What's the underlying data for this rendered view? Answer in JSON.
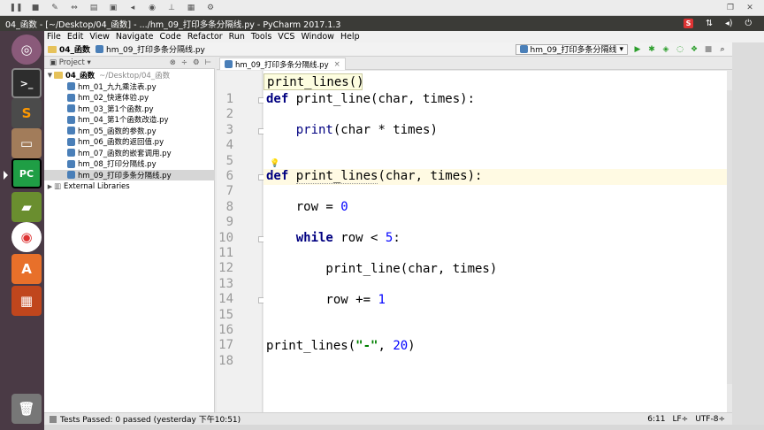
{
  "titlebar": {
    "text": "04_函数 - [~/Desktop/04_函数] - .../hm_09_打印多条分隔线.py - PyCharm 2017.1.3",
    "s_icon": "S"
  },
  "menu": [
    "File",
    "Edit",
    "View",
    "Navigate",
    "Code",
    "Refactor",
    "Run",
    "Tools",
    "VCS",
    "Window",
    "Help"
  ],
  "navbar": {
    "project": "04_函数",
    "file": "hm_09_打印多条分隔线.py",
    "run_config": "hm_09_打印多条分隔线"
  },
  "project_panel": {
    "title": "Project",
    "root": "04_函数",
    "root_path": "~/Desktop/04_函数",
    "files": [
      "hm_01_九九乘法表.py",
      "hm_02_快速体验.py",
      "hm_03_第1个函数.py",
      "hm_04_第1个函数改造.py",
      "hm_05_函数的参数.py",
      "hm_06_函数的返回值.py",
      "hm_07_函数的嵌套调用.py",
      "hm_08_打印分隔线.py",
      "hm_09_打印多条分隔线.py"
    ],
    "selected_index": 8,
    "external": "External Libraries"
  },
  "editor": {
    "tab": "hm_09_打印多条分隔线.py",
    "hint": "print_lines()",
    "line_numbers": [
      "1",
      "2",
      "3",
      "4",
      "5",
      "6",
      "7",
      "8",
      "9",
      "10",
      "11",
      "12",
      "13",
      "14",
      "15",
      "16",
      "17",
      "18"
    ],
    "current_line": 6
  },
  "status": {
    "message": "Tests Passed: 0 passed (yesterday 下午10:51)",
    "position": "6:11",
    "line_sep": "LF÷",
    "encoding": "UTF-8÷"
  },
  "launcher": [
    "ubuntu-logo-icon",
    "terminal-icon",
    "sublime-text-icon",
    "files-icon",
    "pycharm-icon",
    "books-icon",
    "chrome-icon",
    "software-center-icon",
    "workspace-icon",
    "trash-icon"
  ],
  "colors": {
    "keyword": "#000080",
    "string": "#008000",
    "number": "#0000ff",
    "launcher": "#4a3a45",
    "titlebar": "#3b3b37"
  }
}
